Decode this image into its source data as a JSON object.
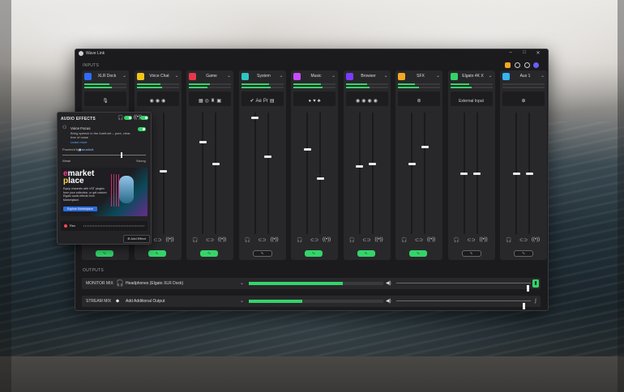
{
  "app": {
    "title": "Wave Link"
  },
  "window_controls": {
    "minimize": "–",
    "maximize": "□",
    "close": "✕"
  },
  "sections": {
    "inputs": "INPUTS",
    "outputs": "OUTPUTS"
  },
  "header_icons": [
    {
      "name": "grid-icon",
      "color": "#f5a623"
    },
    {
      "name": "headphones-icon",
      "color": "#cccccc"
    },
    {
      "name": "gear-icon",
      "color": "#cccccc"
    },
    {
      "name": "account-icon",
      "color": "#6a5cff"
    }
  ],
  "channels": [
    {
      "name": "XLR Dock",
      "color": "#2f6cff",
      "meter_a": 0.6,
      "meter_b": 0.65,
      "app_icons": [
        "🎙"
      ],
      "app_text": "",
      "fader_left": null,
      "fader_right": null,
      "toggle": "on",
      "toggle_glyph": "∿"
    },
    {
      "name": "Voice Chat",
      "color": "#f0c419",
      "meter_a": 0.55,
      "meter_b": 0.6,
      "app_icons": [
        "◉",
        "◉",
        "◉"
      ],
      "app_text": "",
      "fader_left": null,
      "fader_right": 0.52,
      "toggle": "on",
      "toggle_glyph": "∿"
    },
    {
      "name": "Game",
      "color": "#e8374a",
      "meter_a": 0.5,
      "meter_b": 0.45,
      "app_icons": [
        "▦",
        "◎",
        "♜",
        "▣"
      ],
      "app_text": "",
      "fader_left": 0.76,
      "fader_right": 0.58,
      "toggle": "on",
      "toggle_glyph": "∿"
    },
    {
      "name": "System",
      "color": "#2fc6c2",
      "meter_a": 0.65,
      "meter_b": 0.7,
      "app_icons": [
        "✔",
        "Ae",
        "Pr",
        "▤"
      ],
      "app_text": "",
      "fader_left": 0.96,
      "fader_right": 0.64,
      "toggle": "off",
      "toggle_glyph": "∿"
    },
    {
      "name": "Music",
      "color": "#c74cff",
      "meter_a": 0.65,
      "meter_b": 0.7,
      "app_icons": [
        "●",
        "♥",
        "♣"
      ],
      "app_text": "",
      "fader_left": 0.7,
      "fader_right": 0.46,
      "toggle": "on",
      "toggle_glyph": "∿"
    },
    {
      "name": "Browser",
      "color": "#7a3cff",
      "meter_a": 0.5,
      "meter_b": 0.55,
      "app_icons": [
        "◉",
        "◉",
        "◉",
        "◉"
      ],
      "app_text": "",
      "fader_left": 0.56,
      "fader_right": 0.58,
      "toggle": "on",
      "toggle_glyph": "∿"
    },
    {
      "name": "SFX",
      "color": "#f5a623",
      "meter_a": 0.4,
      "meter_b": 0.5,
      "app_icons": [
        "⊛"
      ],
      "app_text": "",
      "fader_left": 0.58,
      "fader_right": 0.72,
      "toggle": "on",
      "toggle_glyph": "∿"
    },
    {
      "name": "Elgato 4K X",
      "color": "#35d46a",
      "meter_a": 0.45,
      "meter_b": 0.5,
      "app_icons": [],
      "app_text": "External Input",
      "fader_left": 0.5,
      "fader_right": 0.5,
      "toggle": "off",
      "toggle_glyph": "∿"
    },
    {
      "name": "Aux 1",
      "color": "#35b6f0",
      "meter_a": 0.0,
      "meter_b": 0.0,
      "app_icons": [
        "⊕"
      ],
      "app_text": "",
      "fader_left": 0.5,
      "fader_right": 0.5,
      "toggle": "off",
      "toggle_glyph": "∿"
    }
  ],
  "footer_glyphs": {
    "listen": "🎧",
    "link": "⊂⊃",
    "stream": "((•))"
  },
  "outputs": [
    {
      "label": "MONITOR MIX",
      "icon": "🎧",
      "device": "Headphones (Elgato XLR Dock)",
      "meter": 0.7,
      "volume": 0.98,
      "tail": "▮",
      "tail_active": true
    },
    {
      "label": "STREAM MIX",
      "icon": "⏺",
      "device": "Add Additional Output",
      "meter": 0.4,
      "volume": 0.95,
      "tail": "∫",
      "tail_active": false
    }
  ],
  "audio_effects": {
    "title": "AUDIO EFFECTS",
    "effect_name": "Voice Focus",
    "effect_desc": "Bring speech in the forefront – pure, clear, free of noise",
    "learn_more": "Learn more",
    "powered_by_label": "Powered by",
    "powered_by_brand": "◼acusticA",
    "slider_value": 0.7,
    "slider_min_label": "Weak",
    "slider_max_label": "Strong",
    "marketplace_logo_a": "marketplace",
    "marketplace_desc": "Equip channels with VST plugins from your collection, or get custom Elgato audio effects from Marketplace.",
    "marketplace_button": "Explore Marketplace",
    "rec_label": "Rec",
    "add_effect": "⊕ Add Effect"
  }
}
